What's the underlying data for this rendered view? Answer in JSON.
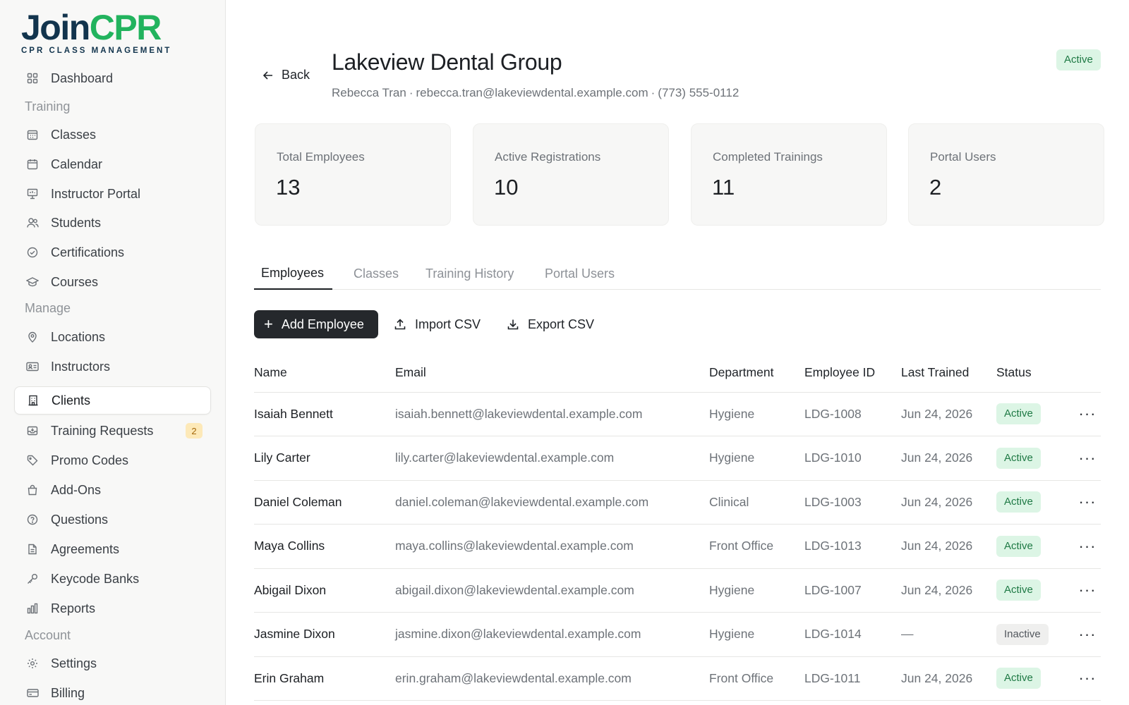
{
  "brand": {
    "name_part1": "Join",
    "name_part2": "CPR",
    "tagline": "CPR CLASS MANAGEMENT"
  },
  "sidebar": {
    "items": [
      {
        "label": "Dashboard",
        "icon": "grid-icon"
      },
      {
        "label": "Classes",
        "icon": "calendar-grid-icon"
      },
      {
        "label": "Calendar",
        "icon": "calendar-icon"
      },
      {
        "label": "Instructor Portal",
        "icon": "presentation-icon"
      },
      {
        "label": "Students",
        "icon": "users-icon"
      },
      {
        "label": "Certifications",
        "icon": "check-circle-icon"
      },
      {
        "label": "Courses",
        "icon": "graduation-cap-icon"
      },
      {
        "label": "Locations",
        "icon": "map-pin-icon"
      },
      {
        "label": "Instructors",
        "icon": "id-card-icon"
      },
      {
        "label": "Clients",
        "icon": "building-icon"
      },
      {
        "label": "Training Requests",
        "icon": "inbox-icon",
        "badge": "2"
      },
      {
        "label": "Promo Codes",
        "icon": "tag-icon"
      },
      {
        "label": "Add-Ons",
        "icon": "shopping-bag-icon"
      },
      {
        "label": "Questions",
        "icon": "help-circle-icon"
      },
      {
        "label": "Agreements",
        "icon": "file-text-icon"
      },
      {
        "label": "Keycode Banks",
        "icon": "key-icon"
      },
      {
        "label": "Reports",
        "icon": "bar-chart-icon"
      },
      {
        "label": "Settings",
        "icon": "gear-icon"
      },
      {
        "label": "Billing",
        "icon": "credit-card-icon"
      }
    ],
    "sections": {
      "training": "Training",
      "manage": "Manage",
      "account": "Account"
    }
  },
  "header": {
    "back_label": "Back",
    "title": "Lakeview Dental Group",
    "contact_name": "Rebecca Tran",
    "contact_email": "rebecca.tran@lakeviewdental.example.com",
    "contact_phone": "(773) 555-0112",
    "separator": "·",
    "status": "Active"
  },
  "stats": [
    {
      "label": "Total Employees",
      "value": "13"
    },
    {
      "label": "Active Registrations",
      "value": "10"
    },
    {
      "label": "Completed Trainings",
      "value": "11"
    },
    {
      "label": "Portal Users",
      "value": "2"
    }
  ],
  "tabs": [
    "Employees",
    "Classes",
    "Training History",
    "Portal Users"
  ],
  "actions": {
    "add": "Add Employee",
    "import": "Import CSV",
    "export": "Export CSV"
  },
  "table": {
    "columns": [
      "Name",
      "Email",
      "Department",
      "Employee ID",
      "Last Trained",
      "Status"
    ],
    "rows": [
      {
        "name": "Isaiah Bennett",
        "email": "isaiah.bennett@lakeviewdental.example.com",
        "department": "Hygiene",
        "employee_id": "LDG-1008",
        "last_trained": "Jun 24, 2026",
        "status": "Active"
      },
      {
        "name": "Lily Carter",
        "email": "lily.carter@lakeviewdental.example.com",
        "department": "Hygiene",
        "employee_id": "LDG-1010",
        "last_trained": "Jun 24, 2026",
        "status": "Active"
      },
      {
        "name": "Daniel Coleman",
        "email": "daniel.coleman@lakeviewdental.example.com",
        "department": "Clinical",
        "employee_id": "LDG-1003",
        "last_trained": "Jun 24, 2026",
        "status": "Active"
      },
      {
        "name": "Maya Collins",
        "email": "maya.collins@lakeviewdental.example.com",
        "department": "Front Office",
        "employee_id": "LDG-1013",
        "last_trained": "Jun 24, 2026",
        "status": "Active"
      },
      {
        "name": "Abigail Dixon",
        "email": "abigail.dixon@lakeviewdental.example.com",
        "department": "Hygiene",
        "employee_id": "LDG-1007",
        "last_trained": "Jun 24, 2026",
        "status": "Active"
      },
      {
        "name": "Jasmine Dixon",
        "email": "jasmine.dixon@lakeviewdental.example.com",
        "department": "Hygiene",
        "employee_id": "LDG-1014",
        "last_trained": "—",
        "status": "Inactive"
      },
      {
        "name": "Erin Graham",
        "email": "erin.graham@lakeviewdental.example.com",
        "department": "Front Office",
        "employee_id": "LDG-1011",
        "last_trained": "Jun 24, 2026",
        "status": "Active"
      }
    ],
    "row_menu": "···"
  },
  "colors": {
    "brand_navy": "#12344d",
    "brand_green": "#22b35e",
    "active_bg": "#dcf5e5",
    "active_text": "#1f7a45",
    "badge_bg": "#fde9b8"
  }
}
